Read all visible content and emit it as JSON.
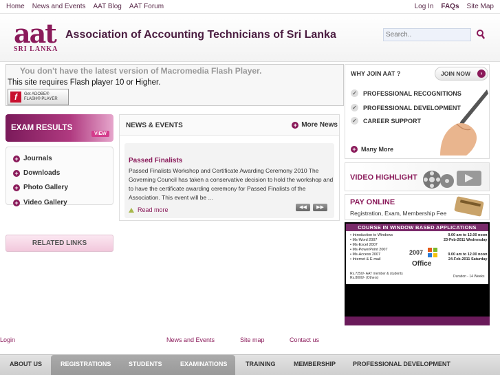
{
  "topbar": {
    "left_links": [
      "Home",
      "News and Events",
      "AAT Blog",
      "AAT Forum"
    ],
    "right_links": [
      "Log In",
      "FAQs",
      "Site Map"
    ]
  },
  "header": {
    "logo_main": "aat",
    "logo_sub": "SRI LANKA",
    "title": "Association of Accounting Technicians of Sri Lanka",
    "search_placeholder": "Search.."
  },
  "flash": {
    "message1": "You don't have the latest version of Macromedia Flash Player.",
    "message2": "This site requires Flash player 10 or Higher.",
    "button_line1": "Get ADOBE®",
    "button_line2": "FLASH® PLAYER"
  },
  "left": {
    "exam_results": "EXAM RESULTS",
    "exam_view": "VIEW",
    "menu": [
      "Journals",
      "Downloads",
      "Photo Gallery",
      "Video Gallery"
    ],
    "related_links": "RELATED LINKS"
  },
  "news": {
    "title": "NEWS & EVENTS",
    "more": "More News",
    "item_title": "Passed Finalists",
    "item_body": "Passed Finalists Workshop and Certificate Awarding Ceremony 2010 The Governing Council has taken a conservative decision to hold the workshop and to have the certificate awarding ceremony for Passed Finalists of the Association. This event will be ...",
    "read_more": "Read more"
  },
  "why": {
    "title": "WHY JOIN AAT ?",
    "join": "JOIN NOW",
    "items": [
      "PROFESSIONAL RECOGNITIONS",
      "PROFESSIONAL DEVELOPMENT",
      "CAREER SUPPORT"
    ],
    "many_more": "Many More"
  },
  "video": {
    "title": "VIDEO HIGHLIGHT"
  },
  "pay": {
    "title": "PAY ONLINE",
    "subtitle": "Registration, Exam, Membership Fee"
  },
  "course": {
    "banner": "COURSE IN WINDOW BASED APPLICATIONS",
    "items": [
      "• Introduction to Windows",
      "• Ms-Word 2007",
      "• Ms-Excel 2007",
      "• Ms-PowerPoint 2007",
      "• Ms-Access 2007",
      "• Internet & E-mail"
    ],
    "time1": "9.00 am to 12.00 noon",
    "date1": "23-Feb-2011 Wednesday",
    "time2": "9.00 am to 12.00 noon",
    "date2": "24-Feb-2011 Saturday",
    "version": "2007",
    "office": "Office",
    "fee1": "Rs.7250/- AAT member & students",
    "fee2": "Rs.8000/- (Others)",
    "duration": "Duration - 14 Weeks"
  },
  "footer_links": [
    "Login",
    "News and Events",
    "Site map",
    "Contact us"
  ],
  "mainnav": [
    "ABOUT US",
    "REGISTRATIONS",
    "STUDENTS",
    "EXAMINATIONS",
    "TRAINING",
    "MEMBERSHIP",
    "PROFESSIONAL DEVELOPMENT"
  ],
  "colors": {
    "brand": "#8a1a5a",
    "nav_active": "#999999"
  }
}
